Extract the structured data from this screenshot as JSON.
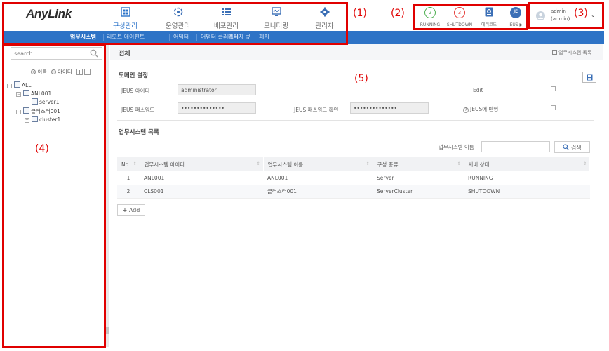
{
  "app": {
    "logo": "AnyLink"
  },
  "top_menu": [
    {
      "label": "구성관리",
      "icon": "config-grid-icon"
    },
    {
      "label": "운영관리",
      "icon": "operation-cog-icon"
    },
    {
      "label": "배포관리",
      "icon": "deploy-list-icon"
    },
    {
      "label": "모니터링",
      "icon": "monitor-icon"
    },
    {
      "label": "관리자",
      "icon": "admin-gear-icon"
    }
  ],
  "status": {
    "running_count": "2",
    "running_label": "RUNNING",
    "shutdown_count": "3",
    "shutdown_label": "SHUTDOWN",
    "errorcode_label": "에러코드",
    "jeus_badge": "JE",
    "jeus_label": "JEUS ▶"
  },
  "user": {
    "name": "admin",
    "role": "(admin)"
  },
  "annotations": {
    "a1": "(1)",
    "a2": "(2)",
    "a3": "(3)",
    "a4": "(4)",
    "a5": "(5)"
  },
  "subnav": [
    "업무시스템",
    "리모트 애이전트",
    "어댑터",
    "어댑터 클러스터",
    "메시지 큐",
    "폐지"
  ],
  "sidebar": {
    "search_placeholder": "search",
    "radio_name": "이름",
    "radio_id": "아이디",
    "tree": {
      "root": "ALL",
      "node1": "ANL001",
      "node1_child": "server1",
      "node2": "클러스터001",
      "node2_child": "cluster1"
    }
  },
  "main": {
    "title": "전체",
    "title_link": "업무시스템 목록",
    "domain_section": "도메인 설정",
    "jeus_id_label": "JEUS 아이디",
    "jeus_id_value": "administrator",
    "edit_label": "Edit",
    "jeus_pw_label": "JEUS 패스워드",
    "jeus_pw_value": "••••••••••••••",
    "jeus_pw_confirm_label": "JEUS 패스워드 확인",
    "jeus_pw_confirm_value": "••••••••••••••",
    "apply_label": "JEUS에 반영",
    "list_section": "업무시스템 목록",
    "filter_label": "업무시스템 이름",
    "search_button": "검색",
    "add_button": "Add",
    "columns": [
      "No",
      "업무시스템 아이디",
      "업무시스템 이름",
      "구성 종류",
      "서버 상태"
    ],
    "rows": [
      [
        "1",
        "ANL001",
        "ANL001",
        "Server",
        "RUNNING"
      ],
      [
        "2",
        "CLS001",
        "클러스터001",
        "ServerCluster",
        "SHUTDOWN"
      ]
    ]
  },
  "colors": {
    "accent": "#2e73c6",
    "running": "#4caf50",
    "shutdown": "#e53935",
    "annotation": "#e00000"
  }
}
